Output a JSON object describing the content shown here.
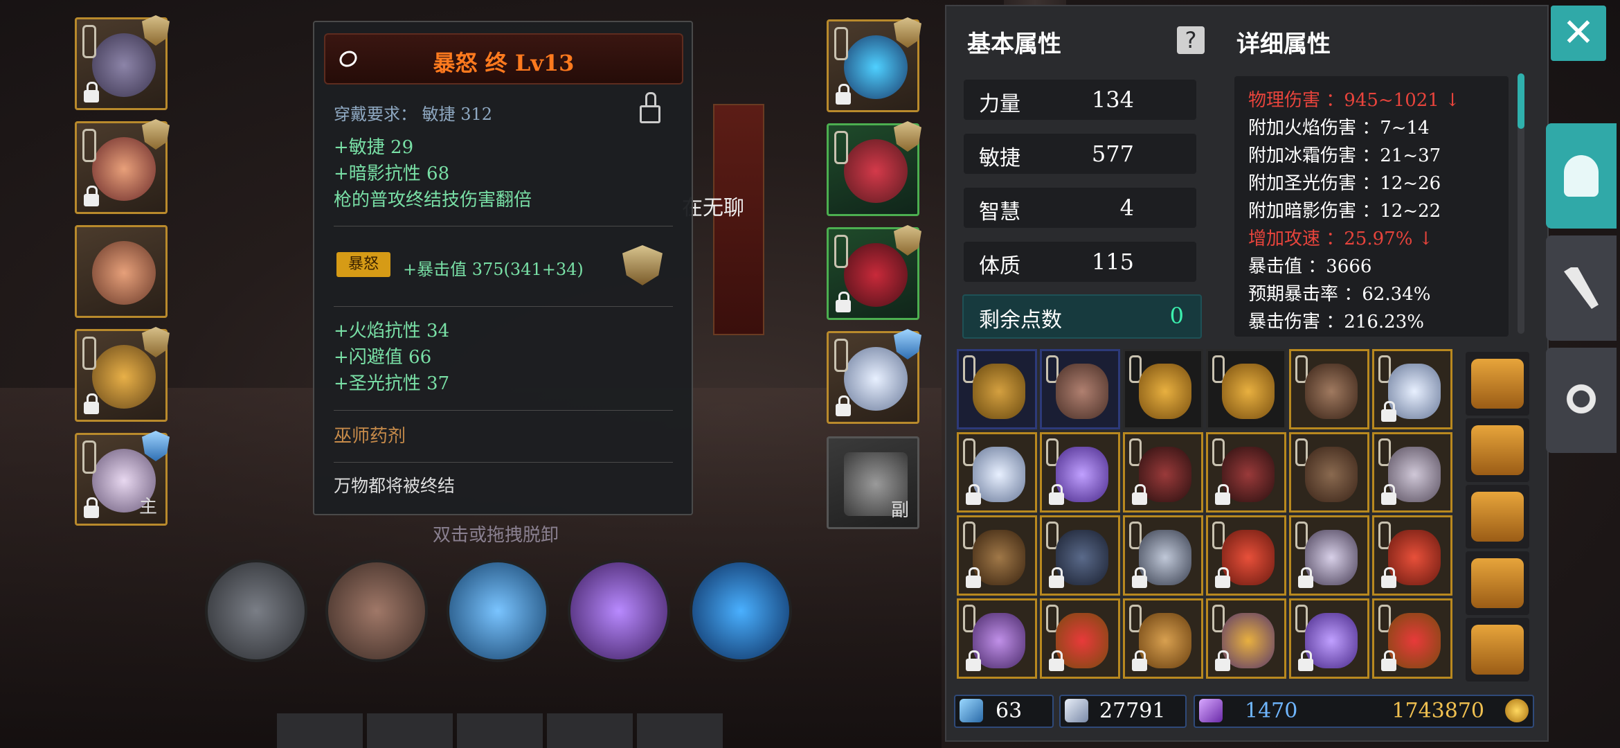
{
  "scene": {
    "npc_text": "在无聊",
    "hint_text": "双击或拖拽脱卸"
  },
  "left_slots": [
    {
      "name": "helmet",
      "shield": "gold",
      "letter": ""
    },
    {
      "name": "chest",
      "shield": "gold",
      "letter": ""
    },
    {
      "name": "shoulder",
      "shield": "",
      "letter": ""
    },
    {
      "name": "ring",
      "shield": "gold",
      "letter": ""
    },
    {
      "name": "main-weapon",
      "shield": "blue",
      "letter": "主"
    }
  ],
  "right_slots": [
    {
      "name": "gloves-blue",
      "shield": "gold",
      "letter": ""
    },
    {
      "name": "gloves-red",
      "shield": "gold",
      "letter": ""
    },
    {
      "name": "boots",
      "shield": "gold",
      "letter": ""
    },
    {
      "name": "ring-silver",
      "shield": "blue",
      "letter": ""
    },
    {
      "name": "off-weapon",
      "shield": "",
      "letter": "副"
    }
  ],
  "tooltip": {
    "title": "暴怒 终 Lv13",
    "requirement": "穿戴要求：  敏捷 312",
    "stats": [
      "+敏捷 29",
      "+暗影抗性 68",
      "枪的普攻终结技伤害翻倍"
    ],
    "enchant_badge": "暴怒",
    "enchant_stat": "+暴击值 375(341+34)",
    "extra_stats": [
      "+火焰抗性 34",
      "+闪避值 66",
      "+圣光抗性 37"
    ],
    "set_name": "巫师药剂",
    "lore": "万物都将被终结"
  },
  "basic": {
    "title": "基本属性",
    "help": "?",
    "rows": [
      {
        "label": "力量",
        "value": "134"
      },
      {
        "label": "敏捷",
        "value": "577"
      },
      {
        "label": "智慧",
        "value": "4"
      },
      {
        "label": "体质",
        "value": "115"
      }
    ],
    "remaining_label": "剩余点数",
    "remaining_value": "0"
  },
  "detail": {
    "title": "详细属性",
    "lines": [
      {
        "text": "物理伤害 ：945~1021 ↓",
        "red": true
      },
      {
        "text": "附加火焰伤害 ：7~14",
        "red": false
      },
      {
        "text": "附加冰霜伤害 ：21~37",
        "red": false
      },
      {
        "text": "附加圣光伤害 ：12~26",
        "red": false
      },
      {
        "text": "附加暗影伤害 ：12~22",
        "red": false
      },
      {
        "text": "增加攻速 ：25.97% ↓",
        "red": true
      },
      {
        "text": "暴击值 ：3666",
        "red": false
      },
      {
        "text": "预期暴击率 ：62.34%",
        "red": false
      },
      {
        "text": "暴击伤害 ：216.23%",
        "red": false
      }
    ]
  },
  "close_label": "✕",
  "side_tabs": [
    "equipment-tab",
    "skills-tab",
    "settings-tab"
  ],
  "currency": {
    "crafting": "63",
    "gems": "27791",
    "crystals": "1470",
    "gold": "1743870"
  },
  "colors": {
    "accent": "#30a9a8",
    "green_text": "#79e0a6",
    "red_text": "#e8443c",
    "title_orange": "#ff7a1e"
  }
}
